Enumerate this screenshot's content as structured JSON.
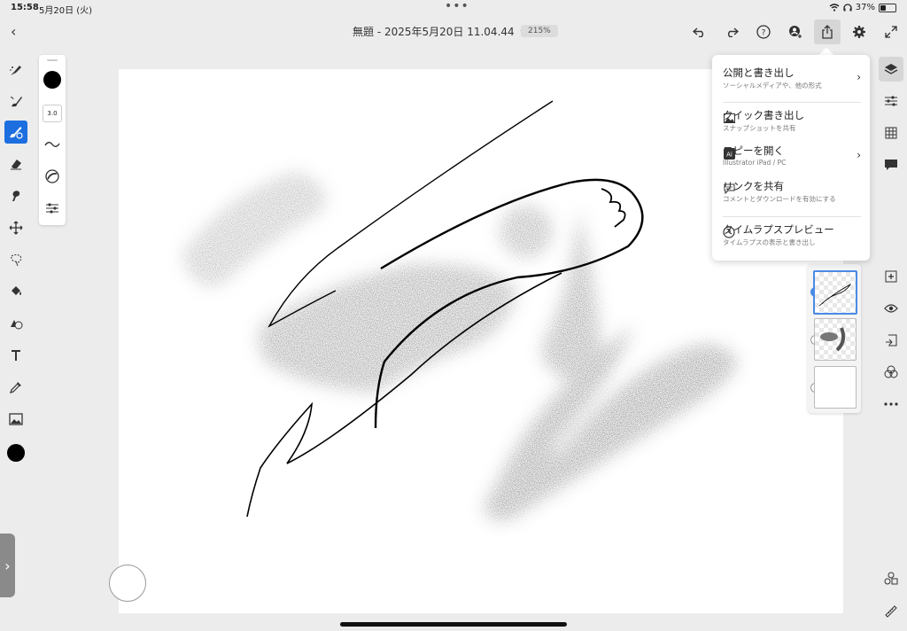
{
  "status": {
    "time": "15:58",
    "date": "5月20日 (火)",
    "battery_percent": "37%",
    "battery_level": 0.37
  },
  "header": {
    "doc_title": "無題 - 2025年5月20日 11.04.44",
    "zoom": "215%"
  },
  "brush_panel": {
    "size": "3.0",
    "color": "#000000"
  },
  "export_menu": {
    "items": [
      {
        "title": "公開と書き出し",
        "subtitle": "ソーシャルメディアや、他の形式",
        "icon": ""
      },
      {
        "title": "クイック書き出し",
        "subtitle": "スナップショットを共有",
        "icon": "image-icon"
      },
      {
        "title": "コピーを開く",
        "subtitle": "Illustrator iPad / PC",
        "icon": "ai-icon",
        "icon_text": "Ai"
      },
      {
        "title": "リンクを共有",
        "subtitle": "コメントとダウンロードを有効にする",
        "icon": "comment-icon"
      },
      {
        "title": "タイムラプスプレビュー",
        "subtitle": "タイムラプスの表示と書き出し",
        "icon": "clock-icon"
      }
    ]
  },
  "colors": {
    "accent": "#1d6fe0",
    "layer_selected": "#4a8ae8",
    "ink": "#000000"
  }
}
